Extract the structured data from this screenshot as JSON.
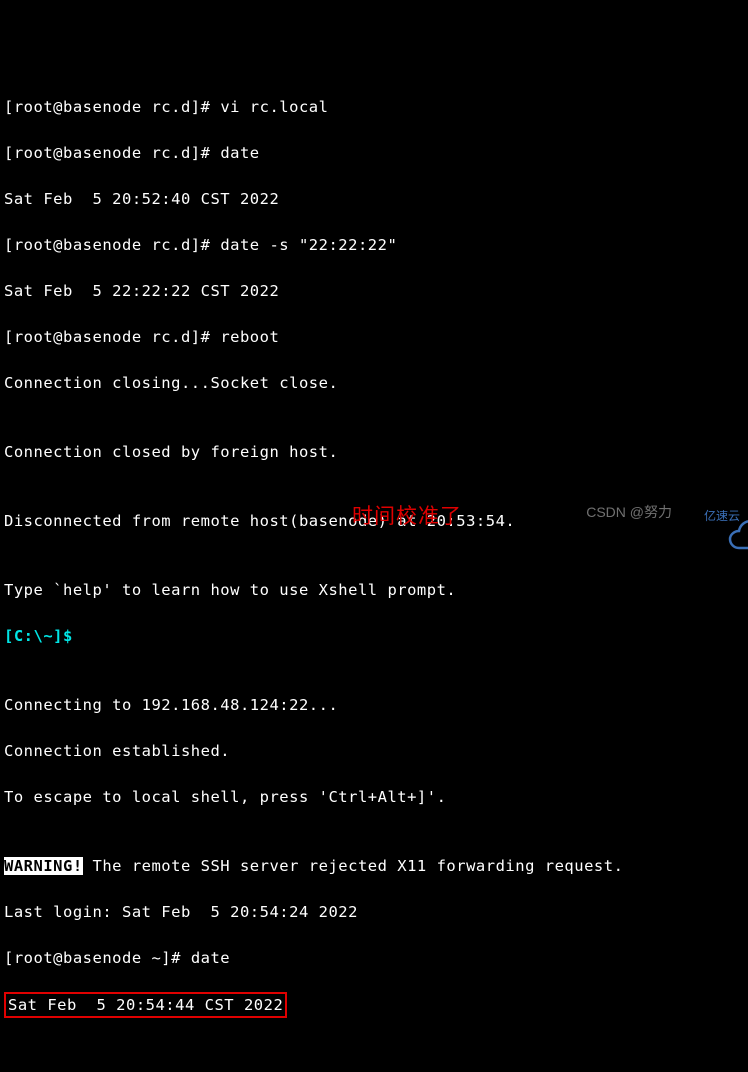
{
  "lines": {
    "l1_prompt": "[root@basenode rc.d]# ",
    "l1_cmd": "vi rc.local",
    "l2_prompt": "[root@basenode rc.d]# ",
    "l2_cmd": "date",
    "l3": "Sat Feb  5 20:52:40 CST 2022",
    "l4_prompt": "[root@basenode rc.d]# ",
    "l4_cmd": "date -s \"22:22:22\"",
    "l5": "Sat Feb  5 22:22:22 CST 2022",
    "l6_prompt": "[root@basenode rc.d]# ",
    "l6_cmd": "reboot",
    "l7": "Connection closing...Socket close.",
    "l8": "",
    "l9": "Connection closed by foreign host.",
    "l10": "",
    "l11": "Disconnected from remote host(basenode) at 20:53:54.",
    "l12": "",
    "l13": "Type `help' to learn how to use Xshell prompt.",
    "l14_prompt": "[C:\\~]$",
    "l14_rest": " ",
    "l15": "",
    "l16": "Connecting to 192.168.48.124:22...",
    "l17": "Connection established.",
    "l18": "To escape to local shell, press 'Ctrl+Alt+]'.",
    "l19": "",
    "l20_warn": "WARNING!",
    "l20_rest": " The remote SSH server rejected X11 forwarding request.",
    "l21": "Last login: Sat Feb  5 20:54:24 2022",
    "l22_prompt": "[root@basenode ~]# ",
    "l22_cmd": "date",
    "l23": "Sat Feb  5 20:54:44 CST 2022"
  },
  "annotation": "时间校准了",
  "watermark": {
    "csdn": "CSDN @努力",
    "brand": "亿速云"
  }
}
